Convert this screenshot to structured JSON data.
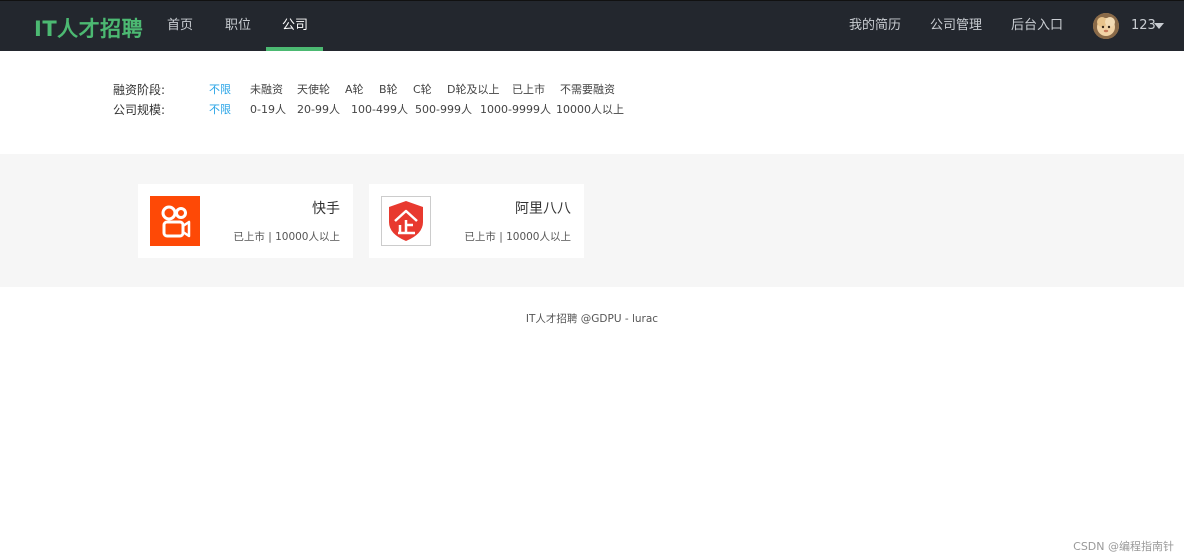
{
  "nav": {
    "brand": "IT人才招聘",
    "items": [
      {
        "label": "首页",
        "active": false
      },
      {
        "label": "职位",
        "active": false
      },
      {
        "label": "公司",
        "active": true
      }
    ],
    "right_items": [
      {
        "label": "我的简历"
      },
      {
        "label": "公司管理"
      },
      {
        "label": "后台入口"
      }
    ],
    "user": {
      "name": "123",
      "avatar_icon": "user-avatar",
      "dropdown_icon": "caret-down-icon"
    },
    "accent_color": "#4cb972",
    "bg_color": "#23272e"
  },
  "filters": {
    "funding": {
      "label": "融资阶段:",
      "options": [
        "不限",
        "未融资",
        "天使轮",
        "A轮",
        "B轮",
        "C轮",
        "D轮及以上",
        "已上市",
        "不需要融资"
      ],
      "selected": "不限"
    },
    "size": {
      "label": "公司规模:",
      "options": [
        "不限",
        "0-19人",
        "20-99人",
        "100-499人",
        "500-999人",
        "1000-9999人",
        "10000人以上"
      ],
      "selected": "不限"
    },
    "selected_color": "#29a4e6"
  },
  "companies": [
    {
      "name": "快手",
      "meta": "已上市 | 10000人以上",
      "logo_icon": "kuaishou-logo",
      "logo_color": "#fe4906"
    },
    {
      "name": "阿里八八",
      "meta": "已上市 | 10000人以上",
      "logo_icon": "enterprise-shield-logo",
      "logo_color": "#e8392f"
    }
  ],
  "footer": {
    "text": "IT人才招聘 @GDPU - lurac"
  },
  "watermark": {
    "text": "CSDN @编程指南针"
  }
}
